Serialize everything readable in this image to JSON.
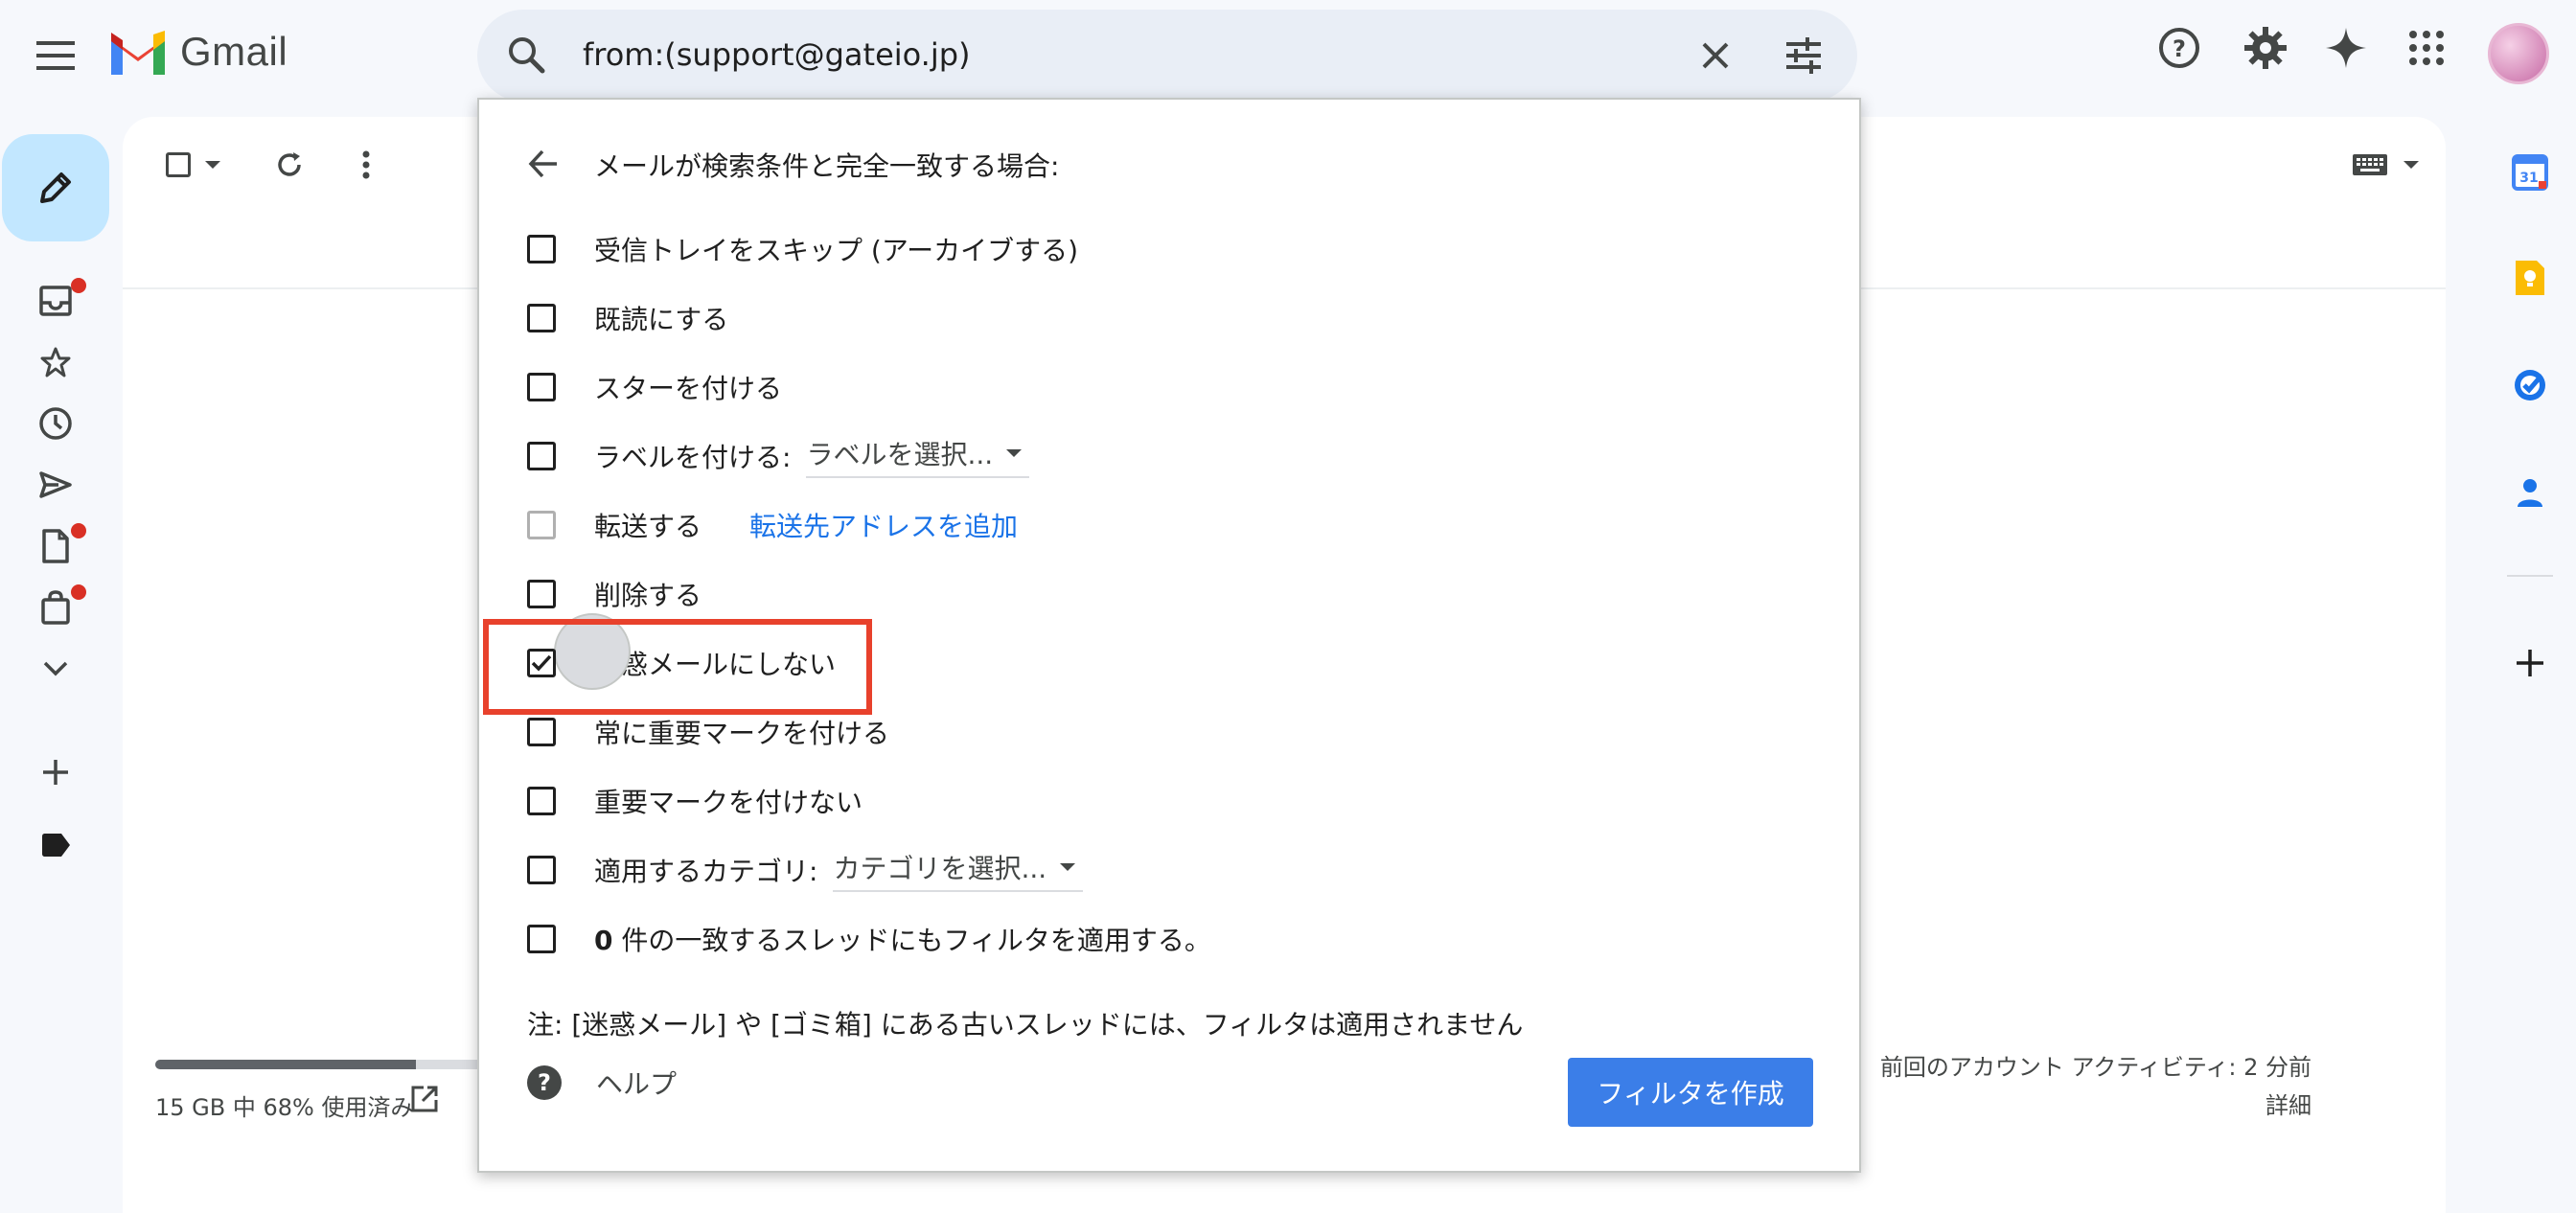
{
  "app": {
    "name": "Gmail"
  },
  "search": {
    "query": "from:(support@gateio.jp)"
  },
  "filter_panel": {
    "title": "メールが検索条件と完全一致する場合:",
    "options": [
      {
        "label": "受信トレイをスキップ (アーカイブする)",
        "checked": false
      },
      {
        "label": "既読にする",
        "checked": false
      },
      {
        "label": "スターを付ける",
        "checked": false
      },
      {
        "label": "ラベルを付ける:",
        "select": "ラベルを選択...",
        "checked": false
      },
      {
        "label": "転送する",
        "link": "転送先アドレスを追加",
        "checked": false,
        "disabled": true
      },
      {
        "label": "削除する",
        "checked": false
      },
      {
        "label": "迷惑メールにしない",
        "checked": true
      },
      {
        "label": "常に重要マークを付ける",
        "checked": false
      },
      {
        "label": "重要マークを付けない",
        "checked": false
      },
      {
        "label": "適用するカテゴリ:",
        "select": "カテゴリを選択...",
        "checked": false
      },
      {
        "count": "0",
        "label": " 件の一致するスレッドにもフィルタを適用する。",
        "checked": false
      }
    ],
    "note": "注: [迷惑メール] や [ゴミ箱] にある古いスレッドには、フィルタは適用されません",
    "help": "ヘルプ",
    "create_button": "フィルタを作成"
  },
  "storage": {
    "text": "15 GB 中 68% 使用済み",
    "percent": 68
  },
  "activity": {
    "line1": "前回のアカウント アクティビティ: 2 分前",
    "line2": "詳細"
  },
  "icons": {
    "header": [
      "menu-icon",
      "search-icon",
      "clear-icon",
      "search-options-icon",
      "help-icon",
      "settings-icon",
      "gemini-icon",
      "apps-icon"
    ],
    "nav": [
      "inbox-icon",
      "star-icon",
      "clock-icon",
      "send-icon",
      "document-icon",
      "shopping-bag-icon",
      "chevron-down-icon",
      "plus-icon",
      "label-icon"
    ],
    "side": [
      "calendar-icon",
      "keep-icon",
      "tasks-icon",
      "contacts-icon",
      "plus-icon"
    ]
  },
  "colors": {
    "accent": "#1a73e8",
    "button": "#3b7ee8",
    "highlight": "#e8412c",
    "compose": "#c2e7ff",
    "badge": "#d93025"
  }
}
